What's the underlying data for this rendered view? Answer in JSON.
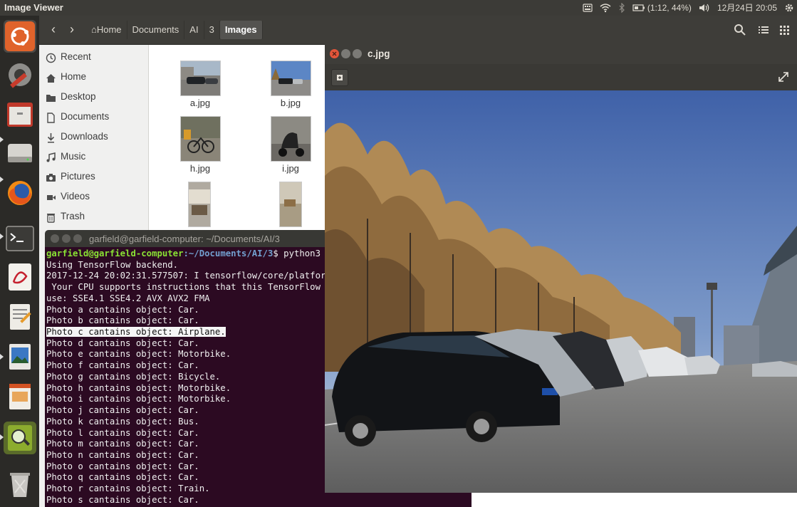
{
  "top_panel": {
    "app_title": "Image Viewer",
    "battery": "(1:12, 44%)",
    "datetime": "12月24日 20:05"
  },
  "launcher": {
    "items": [
      "ubuntu-dash-icon",
      "system-settings-icon",
      "files-icon",
      "disk-icon",
      "firefox-icon",
      "terminal-icon",
      "document-viewer-icon",
      "text-editor-icon",
      "image-viewer-icon",
      "impress-icon",
      "image-magnifier-icon",
      "trash-icon"
    ]
  },
  "files": {
    "breadcrumbs": [
      "Home",
      "Documents",
      "AI",
      "3",
      "Images"
    ],
    "sidebar": [
      "Recent",
      "Home",
      "Desktop",
      "Documents",
      "Downloads",
      "Music",
      "Pictures",
      "Videos",
      "Trash"
    ],
    "thumbnails": [
      "a.jpg",
      "b.jpg",
      "h.jpg",
      "i.jpg",
      "",
      ""
    ]
  },
  "terminal": {
    "title": "garfield@garfield-computer: ~/Documents/AI/3",
    "prompt_user": "garfield@garfield-computer",
    "prompt_path": ":~/Documents/AI/3",
    "command": "$ python3",
    "lines": [
      "Using TensorFlow backend.",
      "2017-12-24 20:02:31.577507: I tensorflow/core/platfor",
      " Your CPU supports instructions that this TensorFlow ",
      "use: SSE4.1 SSE4.2 AVX AVX2 FMA",
      "Photo a cantains object: Car.",
      "Photo b cantains object: Car.",
      "Photo c cantains object: Airplane.",
      "Photo d cantains object: Car.",
      "Photo e cantains object: Motorbike.",
      "Photo f cantains object: Car.",
      "Photo g cantains object: Bicycle.",
      "Photo h cantains object: Motorbike.",
      "Photo i cantains object: Motorbike.",
      "Photo j cantains object: Car.",
      "Photo k cantains object: Bus.",
      "Photo l cantains object: Car.",
      "Photo m cantains object: Car.",
      "Photo n cantains object: Car.",
      "Photo o cantains object: Car.",
      "Photo q cantains object: Car.",
      "Photo r cantains object: Train.",
      "Photo s cantains object: Car."
    ],
    "highlight_line": 6
  },
  "viewer": {
    "title": "c.jpg"
  }
}
